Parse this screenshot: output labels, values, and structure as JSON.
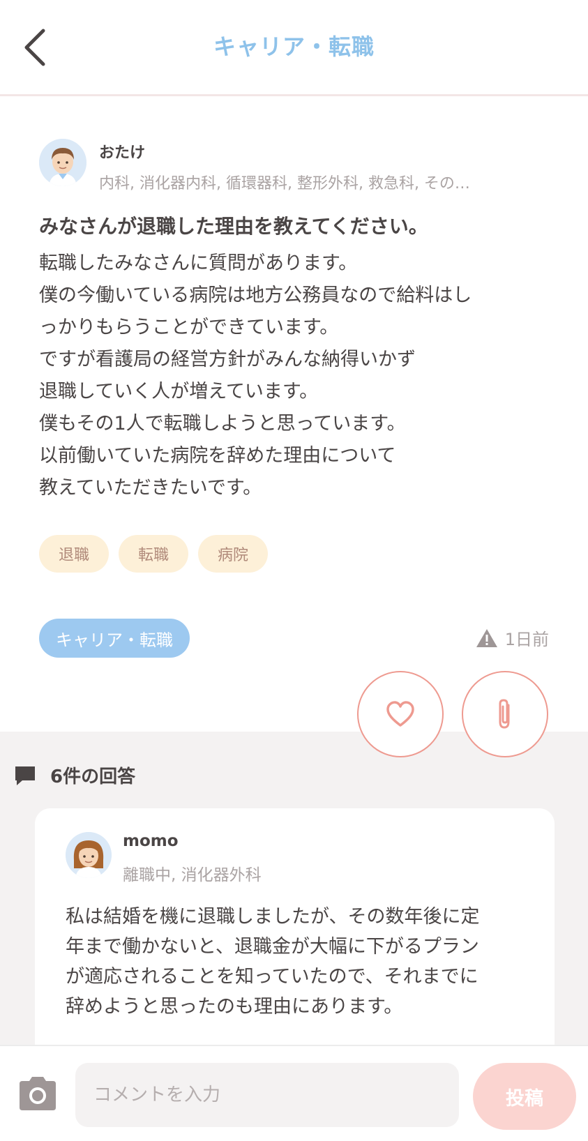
{
  "header": {
    "title": "キャリア・転職"
  },
  "post": {
    "author": {
      "name": "おたけ",
      "specialties": "内科, 消化器内科, 循環器科, 整形外科, 救急科, その…"
    },
    "title": "みなさんが退職した理由を教えてください。",
    "body": "転職したみなさんに質問があります。\n僕の今働いている病院は地方公務員なので給料はし\nっかりもらうことができています。\nですが看護局の経営方針がみんな納得いかず\n退職していく人が増えています。\n僕もその1人で転職しようと思っています。\n以前働いていた病院を辞めた理由について\n教えていただきたいです。",
    "tags": [
      "退職",
      "転職",
      "病院"
    ],
    "category": "キャリア・転職",
    "time": "1日前"
  },
  "answers": {
    "count_label": "6件の回答",
    "items": [
      {
        "name": "momo",
        "meta": "離職中, 消化器外科",
        "body": "私は結婚を機に退職しましたが、その数年後に定\n年まで働かないと、退職金が大幅に下がるプラン\nが適応されることを知っていたので、それまでに\n辞めようと思ったのも理由にあります。"
      }
    ]
  },
  "comment_bar": {
    "placeholder": "コメントを入力",
    "submit_label": "投稿"
  },
  "colors": {
    "accent_blue": "#8ec2ea",
    "category_badge": "#9dc9f0",
    "tag_bg": "#fdf0d8",
    "like_border": "#ee9a90",
    "submit_bg": "#fbd4d0"
  },
  "icons": [
    "back-arrow-icon",
    "warning-icon",
    "heart-icon",
    "paperclip-icon",
    "comment-icon",
    "camera-icon"
  ]
}
